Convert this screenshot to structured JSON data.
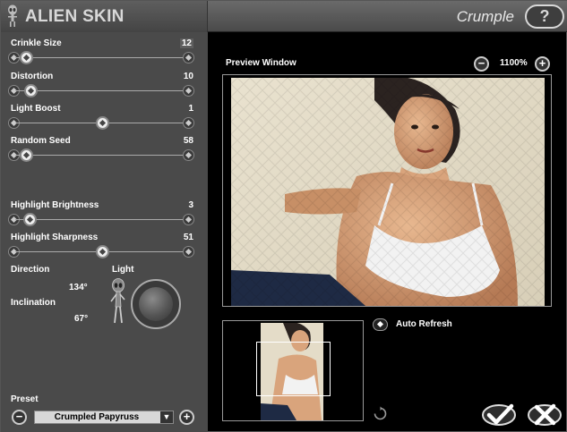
{
  "header": {
    "brand": "ALIEN SKIN",
    "plugin_title": "Crumple",
    "help_label": "?"
  },
  "params": {
    "crinkle_size": {
      "label": "Crinkle Size",
      "value": "12",
      "fraction": 0.06
    },
    "distortion": {
      "label": "Distortion",
      "value": "10",
      "fraction": 0.09
    },
    "light_boost": {
      "label": "Light Boost",
      "value": "1",
      "fraction": 0.5
    },
    "random_seed": {
      "label": "Random Seed",
      "value": "58",
      "fraction": 0.06
    },
    "highlight_brightness": {
      "label": "Highlight Brightness",
      "value": "3",
      "fraction": 0.08
    },
    "highlight_sharpness": {
      "label": "Highlight Sharpness",
      "value": "51",
      "fraction": 0.5
    }
  },
  "lighting": {
    "direction_label": "Direction",
    "direction_value": "134°",
    "inclination_label": "Inclination",
    "inclination_value": "67°",
    "light_label": "Light"
  },
  "preset": {
    "label": "Preset",
    "value": "Crumpled Papyruss",
    "minus_label": "−",
    "plus_label": "+"
  },
  "preview": {
    "title": "Preview Window",
    "zoom": "1100%",
    "zoom_minus_label": "−",
    "zoom_plus_label": "+"
  },
  "auto_refresh": {
    "label": "Auto Refresh"
  },
  "icons": {
    "logo": "alien-icon",
    "help": "question-icon",
    "refresh": "refresh-icon",
    "ok": "checkmark-icon",
    "cancel": "x-mark-icon"
  }
}
